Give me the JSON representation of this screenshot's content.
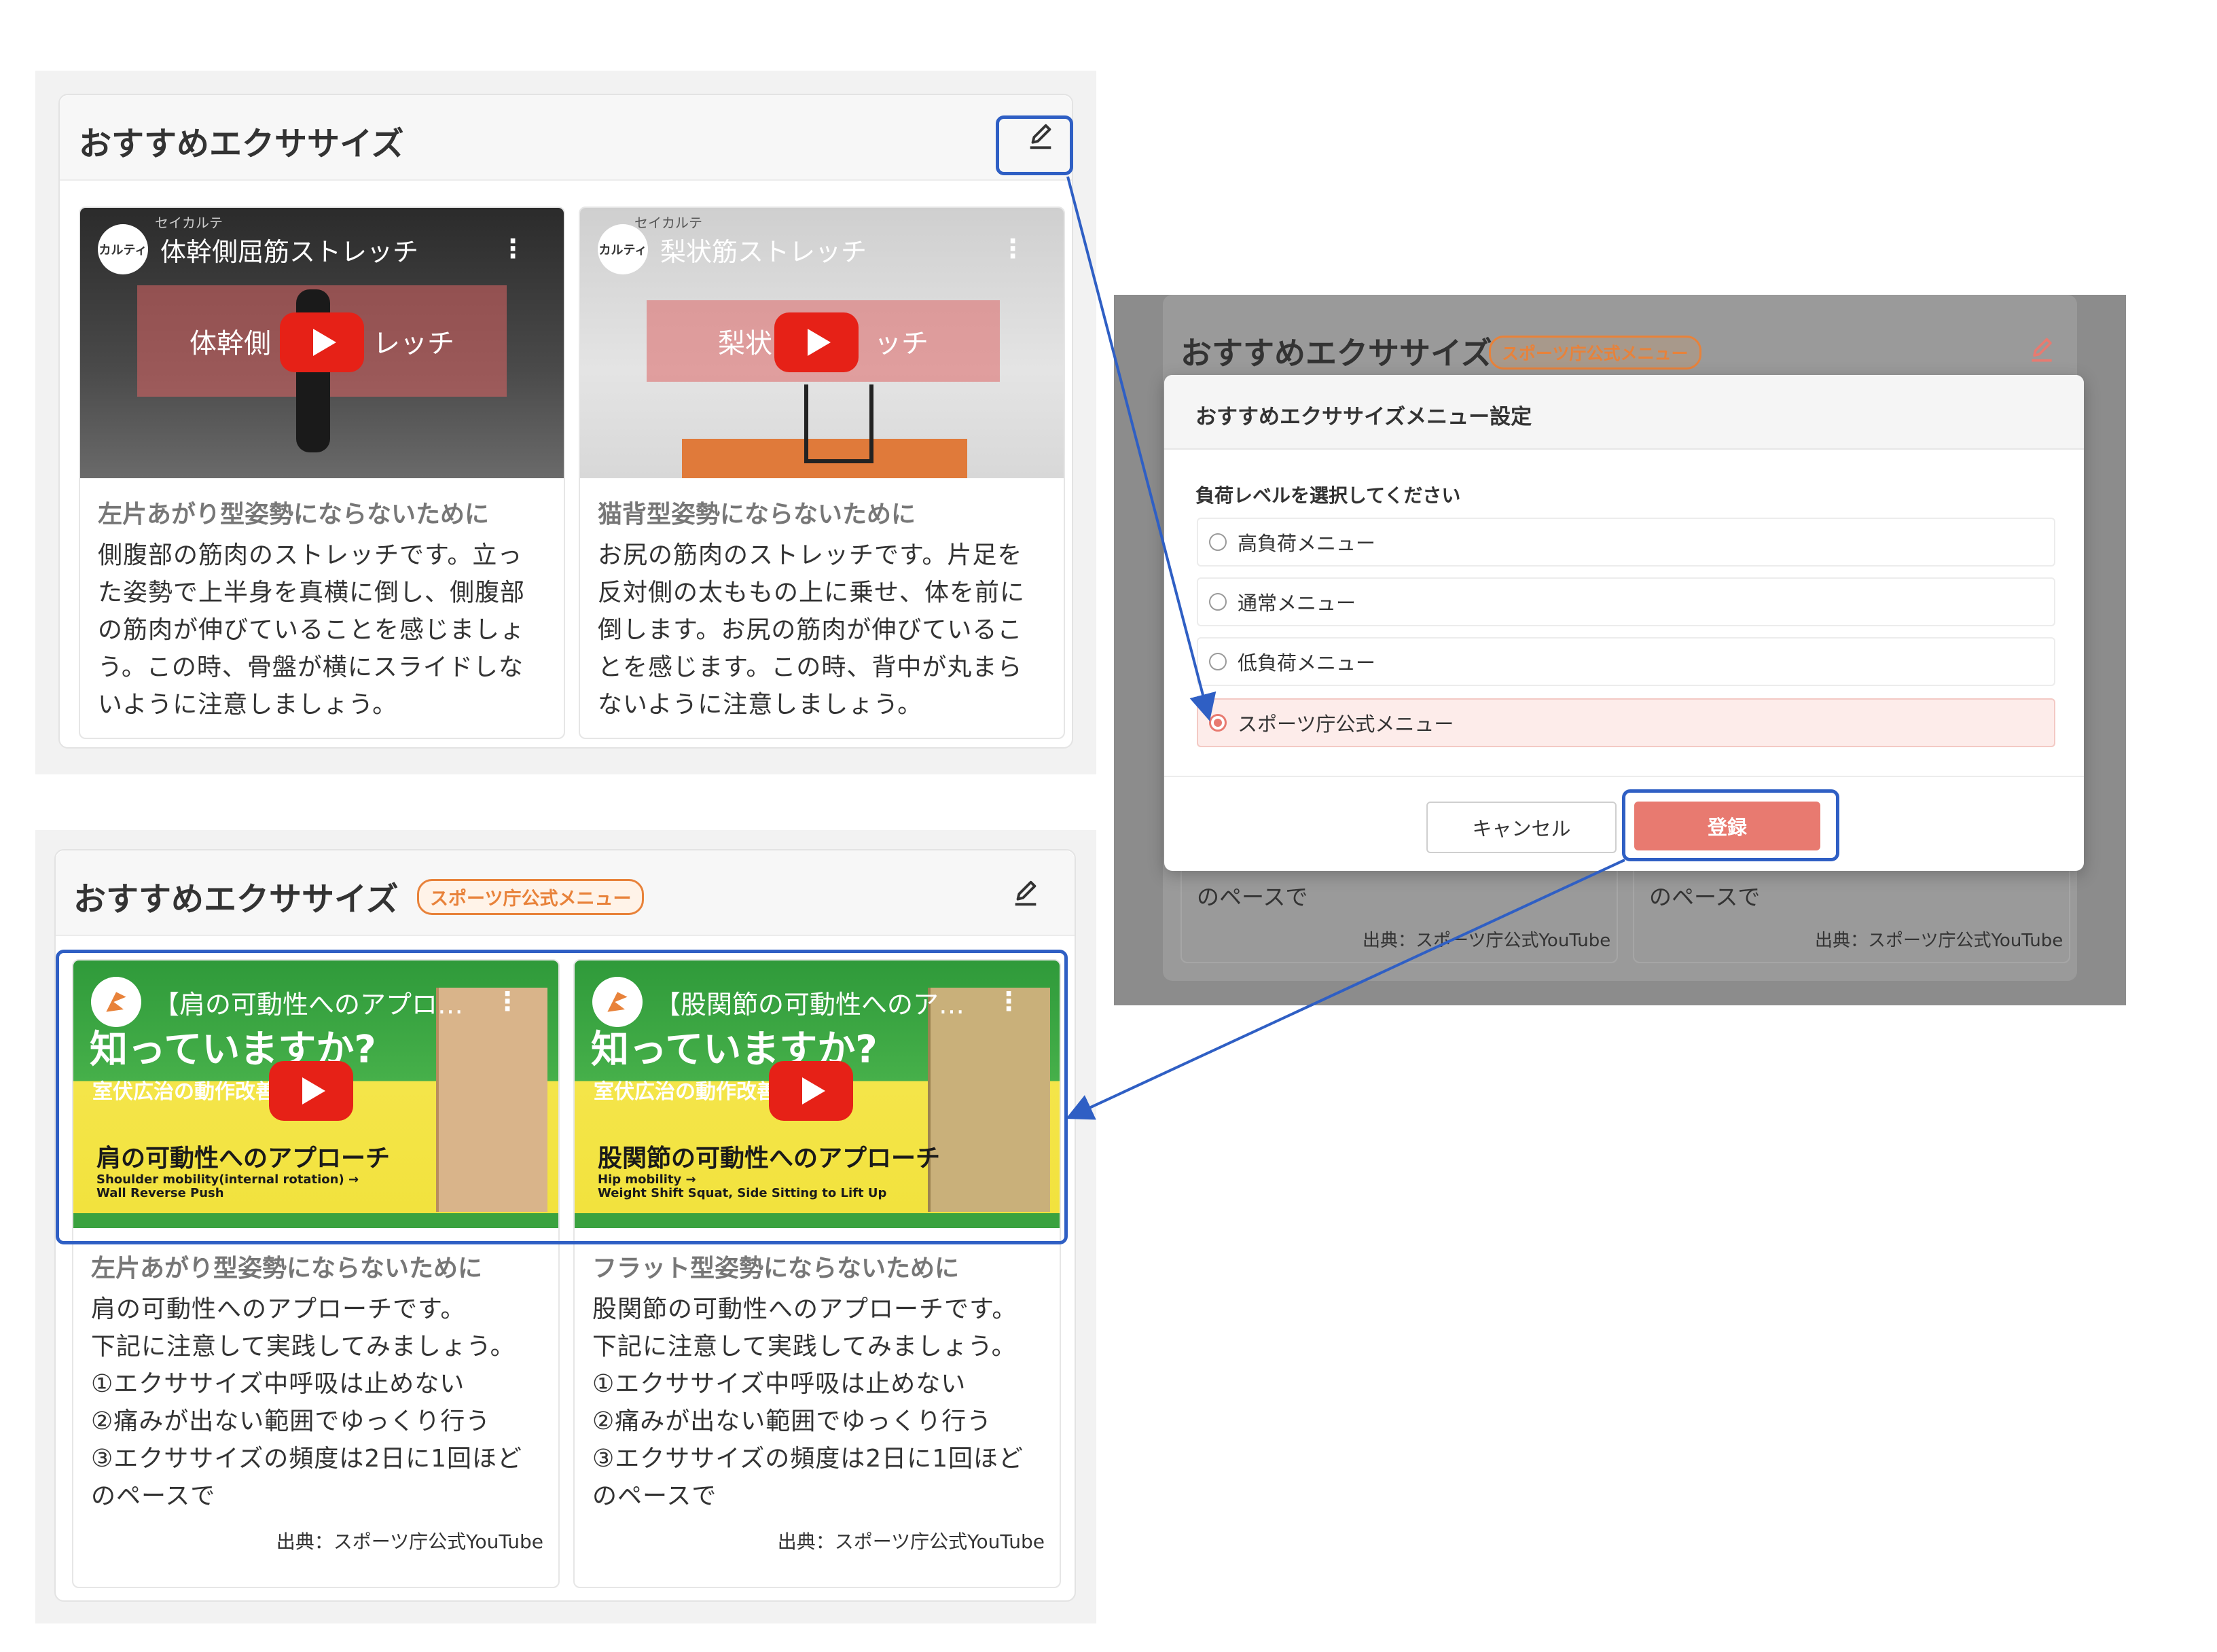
{
  "panel_top": {
    "title": "おすすめエクササイズ",
    "cards": [
      {
        "video_title": "体幹側屈筋ストレッチ",
        "channel_icon": "カルティ",
        "channel_name": "セイカルテ",
        "banner_left": "体幹側",
        "banner_right": "レッチ",
        "subtitle": "左片あがり型姿勢にならないために",
        "description": "側腹部の筋肉のストレッチです。立った姿勢で上半身を真横に倒し、側腹部の筋肉が伸びていることを感じましょう。この時、骨盤が横にスライドしないように注意しましょう。"
      },
      {
        "video_title": "梨状筋ストレッチ",
        "channel_icon": "カルティ",
        "channel_name": "セイカルテ",
        "banner_left": "梨状",
        "banner_right": "ッチ",
        "subtitle": "猫背型姿勢にならないために",
        "description": "お尻の筋肉のストレッチです。片足を反対側の太ももの上に乗せ、体を前に倒します。お尻の筋肉が伸びていることを感じます。この時、背中が丸まらないように注意しましょう。"
      }
    ]
  },
  "panel_bottom": {
    "title": "おすすめエクササイズ",
    "badge": "スポーツ庁公式メニュー",
    "cards": [
      {
        "video_title": "【肩の可動性へのアプロー...",
        "thumb_line1": "知っていますか?",
        "thumb_line2": "室伏広治の動作改善",
        "thumb_heading": "肩の可動性へのアプローチ",
        "thumb_caption1": "Shoulder mobility(internal rotation) →",
        "thumb_caption2": "Wall Reverse Push",
        "subtitle": "左片あがり型姿勢にならないために",
        "description": "肩の可動性へのアプローチです。\n下記に注意して実践してみましょう。\n①エクササイズ中呼吸は止めない\n②痛みが出ない範囲でゆっくり行う\n③エクササイズの頻度は2日に1回ほどのペースで",
        "source": "出典：スポーツ庁公式YouTube"
      },
      {
        "video_title": "【股関節の可動性へのアプ...",
        "thumb_line1": "知っていますか?",
        "thumb_line2": "室伏広治の動作改善",
        "thumb_heading": "股関節の可動性へのアプローチ",
        "thumb_caption1": "Hip mobility →",
        "thumb_caption2": "Weight Shift Squat, Side Sitting to Lift Up",
        "subtitle": "フラット型姿勢にならないために",
        "description": "股関節の可動性へのアプローチです。\n下記に注意して実践してみましょう。\n①エクササイズ中呼吸は止めない\n②痛みが出ない範囲でゆっくり行う\n③エクササイズの頻度は2日に1回ほどのペースで",
        "source": "出典：スポーツ庁公式YouTube"
      }
    ]
  },
  "modal_panel": {
    "bg_title": "おすすめエクササイズ",
    "bg_badge": "スポーツ庁公式メニュー",
    "bg_card_text": "のペースで",
    "bg_card_source": "出典：スポーツ庁公式YouTube",
    "dialog": {
      "title": "おすすめエクササイズメニュー設定",
      "prompt": "負荷レベルを選択してください",
      "options": [
        "高負荷メニュー",
        "通常メニュー",
        "低負荷メニュー",
        "スポーツ庁公式メニュー"
      ],
      "selected_index": 3,
      "cancel_label": "キャンセル",
      "submit_label": "登録"
    }
  },
  "colors": {
    "highlight": "#2f5fc4",
    "accent": "#e87a70",
    "badge": "#e8823a"
  }
}
